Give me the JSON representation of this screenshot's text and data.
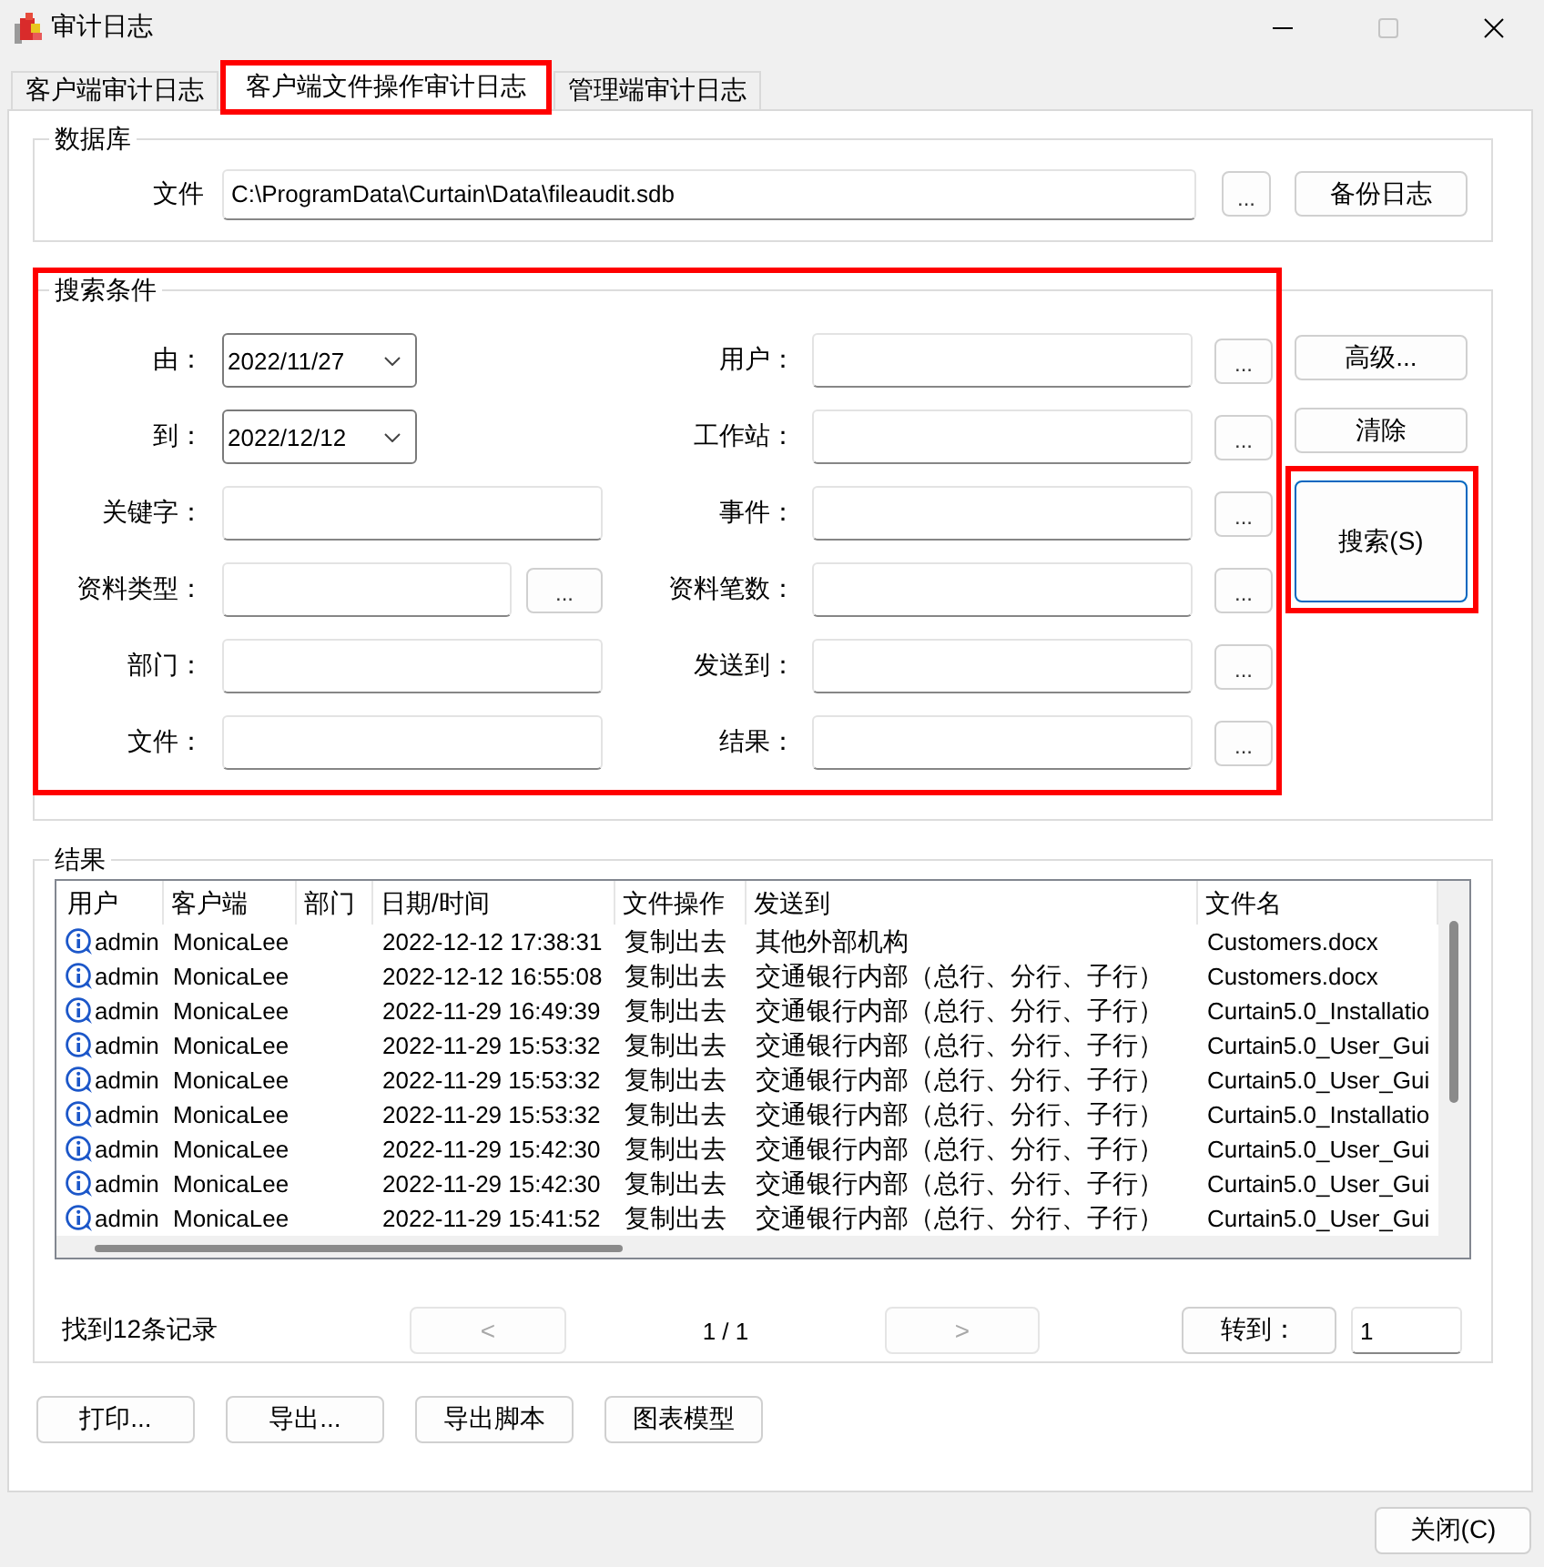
{
  "window": {
    "title": "审计日志",
    "maximize_disabled": true
  },
  "tabs": [
    {
      "label": "客户端审计日志",
      "selected": false,
      "highlighted": false
    },
    {
      "label": "客户端文件操作审计日志",
      "selected": true,
      "highlighted": true
    },
    {
      "label": "管理端审计日志",
      "selected": false,
      "highlighted": false
    }
  ],
  "database": {
    "title": "数据库",
    "label": "文件",
    "value": "C:\\ProgramData\\Curtain\\Data\\fileaudit.sdb",
    "browse_button": "...",
    "backup_button": "备份日志"
  },
  "search": {
    "title": "搜索条件",
    "highlighted": true,
    "left_fields": [
      {
        "label": "由：",
        "kind": "date",
        "value": "2022/11/27"
      },
      {
        "label": "到：",
        "kind": "date",
        "value": "2022/12/12"
      },
      {
        "label": "关键字：",
        "kind": "text"
      },
      {
        "label": "资料类型：",
        "kind": "text_browse",
        "button": "..."
      },
      {
        "label": "部门：",
        "kind": "text"
      },
      {
        "label": "文件：",
        "kind": "text"
      }
    ],
    "right_fields": [
      {
        "label": "用户：",
        "button": "..."
      },
      {
        "label": "工作站：",
        "button": "..."
      },
      {
        "label": "事件：",
        "button": "..."
      },
      {
        "label": "资料笔数：",
        "button": "..."
      },
      {
        "label": "发送到：",
        "button": "..."
      },
      {
        "label": "结果：",
        "button": "..."
      }
    ],
    "buttons": [
      {
        "label": "高级...",
        "kind": "normal",
        "highlighted": false
      },
      {
        "label": "清除",
        "kind": "normal",
        "highlighted": false
      },
      {
        "label": "搜索(S)",
        "kind": "primary",
        "highlighted": true
      }
    ]
  },
  "results": {
    "title": "结果",
    "columns": [
      "用户",
      "客户端",
      "部门",
      "日期/时间",
      "文件操作",
      "发送到",
      "文件名"
    ],
    "rows": [
      {
        "user": "admin",
        "client": "MonicaLee",
        "datetime": "2022-12-12 17:38:31",
        "operation": "复制出去",
        "sent_to": "其他外部机构",
        "file_name": "Customers.docx"
      },
      {
        "user": "admin",
        "client": "MonicaLee",
        "datetime": "2022-12-12 16:55:08",
        "operation": "复制出去",
        "sent_to": "交通银行内部（总行、分行、子行）",
        "file_name": "Customers.docx"
      },
      {
        "user": "admin",
        "client": "MonicaLee",
        "datetime": "2022-11-29 16:49:39",
        "operation": "复制出去",
        "sent_to": "交通银行内部（总行、分行、子行）",
        "file_name": "Curtain5.0_Installatio"
      },
      {
        "user": "admin",
        "client": "MonicaLee",
        "datetime": "2022-11-29 15:53:32",
        "operation": "复制出去",
        "sent_to": "交通银行内部（总行、分行、子行）",
        "file_name": "Curtain5.0_User_Gui"
      },
      {
        "user": "admin",
        "client": "MonicaLee",
        "datetime": "2022-11-29 15:53:32",
        "operation": "复制出去",
        "sent_to": "交通银行内部（总行、分行、子行）",
        "file_name": "Curtain5.0_User_Gui"
      },
      {
        "user": "admin",
        "client": "MonicaLee",
        "datetime": "2022-11-29 15:53:32",
        "operation": "复制出去",
        "sent_to": "交通银行内部（总行、分行、子行）",
        "file_name": "Curtain5.0_Installatio"
      },
      {
        "user": "admin",
        "client": "MonicaLee",
        "datetime": "2022-11-29 15:42:30",
        "operation": "复制出去",
        "sent_to": "交通银行内部（总行、分行、子行）",
        "file_name": "Curtain5.0_User_Gui"
      },
      {
        "user": "admin",
        "client": "MonicaLee",
        "datetime": "2022-11-29 15:42:30",
        "operation": "复制出去",
        "sent_to": "交通银行内部（总行、分行、子行）",
        "file_name": "Curtain5.0_User_Gui"
      },
      {
        "user": "admin",
        "client": "MonicaLee",
        "datetime": "2022-11-29 15:41:52",
        "operation": "复制出去",
        "sent_to": "交通银行内部（总行、分行、子行）",
        "file_name": "Curtain5.0_User_Gui"
      }
    ]
  },
  "pager": {
    "summary": "找到12条记录",
    "prev": {
      "label": "<",
      "disabled": true
    },
    "page": "1 / 1",
    "next": {
      "label": ">",
      "disabled": true
    },
    "goto_button": "转到：",
    "goto_value": "1"
  },
  "actions": [
    "打印...",
    "导出...",
    "导出脚本",
    "图表模型"
  ],
  "close_button": "关闭(C)"
}
